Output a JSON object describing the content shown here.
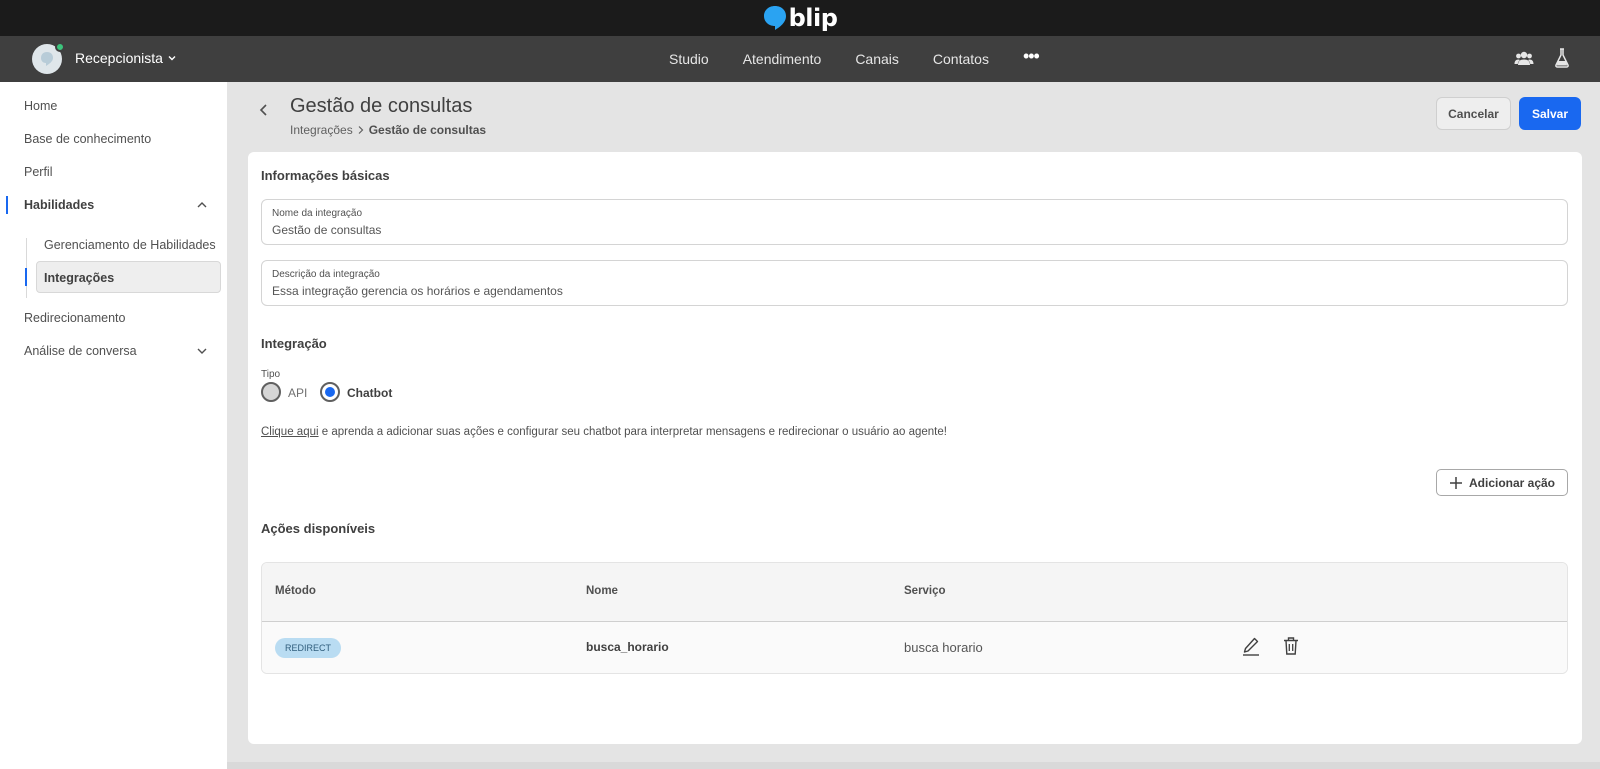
{
  "brand": {
    "name": "blip"
  },
  "nav": {
    "bot_name": "Recepcionista",
    "items": [
      "Studio",
      "Atendimento",
      "Canais",
      "Contatos"
    ],
    "more": "•••"
  },
  "sidebar": {
    "items": [
      {
        "label": "Home"
      },
      {
        "label": "Base de conhecimento"
      },
      {
        "label": "Perfil"
      },
      {
        "label": "Habilidades"
      },
      {
        "label": "Redirecionamento"
      },
      {
        "label": "Análise de conversa"
      }
    ],
    "subitems": [
      {
        "label": "Gerenciamento de Habilidades"
      },
      {
        "label": "Integrações"
      }
    ]
  },
  "header": {
    "title": "Gestão de consultas",
    "breadcrumb": [
      "Integrações",
      "Gestão de consultas"
    ],
    "cancel_label": "Cancelar",
    "save_label": "Salvar"
  },
  "form": {
    "basic_title": "Informações básicas",
    "name_label": "Nome da integração",
    "name_value": "Gestão de consultas",
    "desc_label": "Descrição da integração",
    "desc_value": "Essa integração gerencia os horários e agendamentos",
    "integration_title": "Integração",
    "type_label": "Tipo",
    "type_options": [
      "API",
      "Chatbot"
    ],
    "type_selected": "Chatbot",
    "help_link": "Clique aqui",
    "help_text": " e aprenda a adicionar suas ações e configurar seu chatbot para interpretar mensagens e redirecionar o usuário ao agente!",
    "add_action_label": "Adicionar ação"
  },
  "actions": {
    "title": "Ações disponíveis",
    "columns": [
      "Método",
      "Nome",
      "Serviço"
    ],
    "rows": [
      {
        "method": "REDIRECT",
        "name": "busca_horario",
        "service": "busca horario"
      }
    ]
  },
  "colors": {
    "accent": "#1968f0",
    "online": "#3cc47c",
    "badge_bg": "#b9dcf2"
  }
}
